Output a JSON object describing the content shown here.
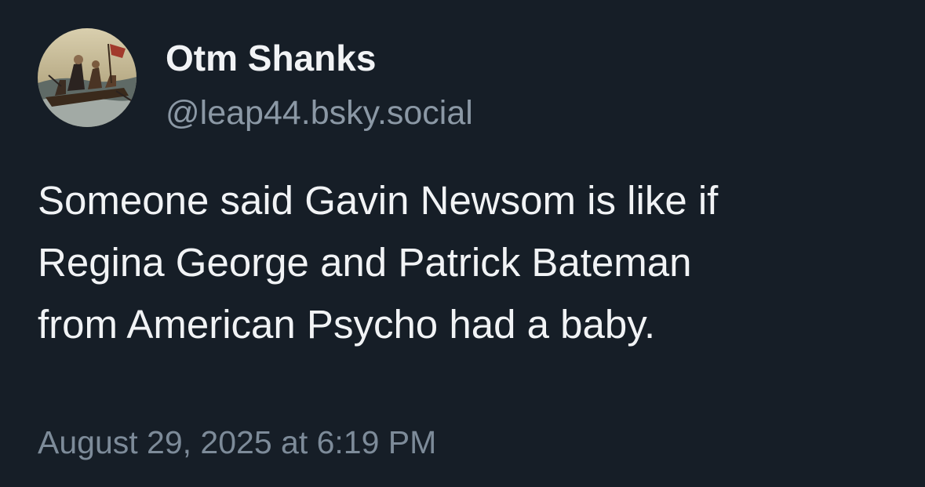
{
  "author": {
    "display_name": "Otm Shanks",
    "handle": "@leap44.bsky.social",
    "avatar_icon": "painting-avatar-icon"
  },
  "post": {
    "text_lines": [
      "Someone said Gavin Newsom is like if",
      "Regina George and Patrick Bateman",
      "from American Psycho had a baby."
    ],
    "timestamp": "August 29, 2025 at 6:19 PM"
  },
  "colors": {
    "background": "#161e27",
    "primary_text": "#f1f3f5",
    "secondary_text": "#8b98a5"
  }
}
